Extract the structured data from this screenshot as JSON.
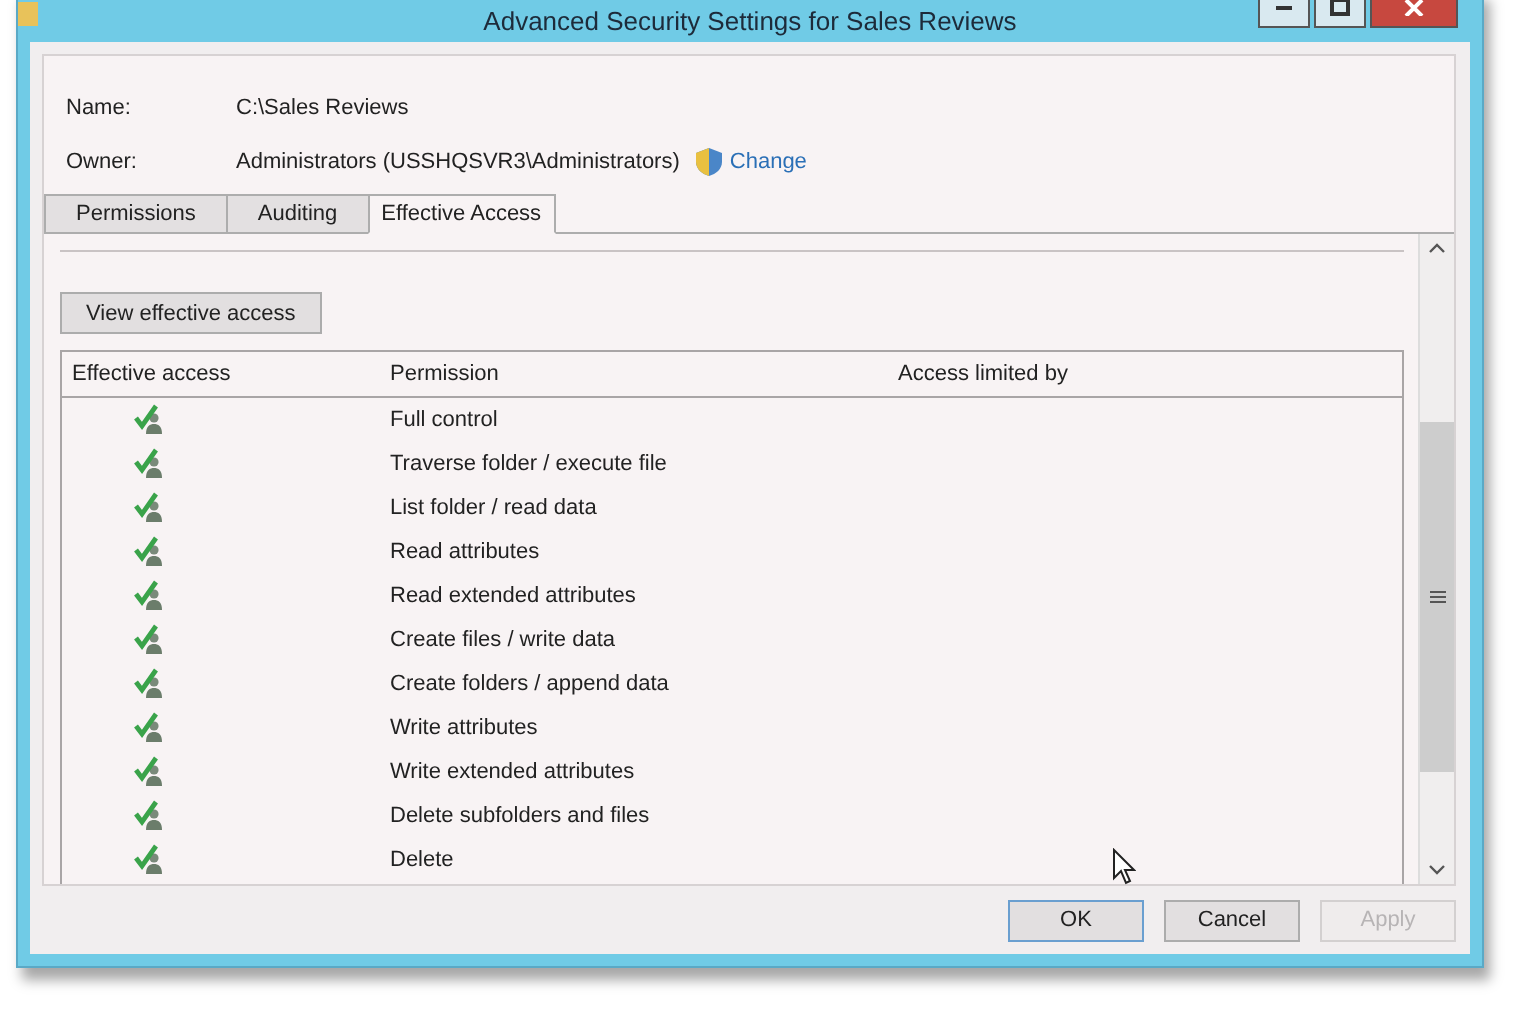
{
  "window": {
    "title": "Advanced Security Settings for Sales Reviews"
  },
  "name": {
    "label": "Name:",
    "value": "C:\\Sales Reviews"
  },
  "owner": {
    "label": "Owner:",
    "value": "Administrators (USSHQSVR3\\Administrators)",
    "change_link": "Change"
  },
  "tabs": [
    {
      "label": "Permissions",
      "selected": false
    },
    {
      "label": "Auditing",
      "selected": false
    },
    {
      "label": "Effective Access",
      "selected": true
    }
  ],
  "view_button": "View effective access",
  "table": {
    "columns": [
      "Effective access",
      "Permission",
      "Access limited by"
    ],
    "rows": [
      {
        "permission": "Full control"
      },
      {
        "permission": "Traverse folder / execute file"
      },
      {
        "permission": "List folder / read data"
      },
      {
        "permission": "Read attributes"
      },
      {
        "permission": "Read extended attributes"
      },
      {
        "permission": "Create files / write data"
      },
      {
        "permission": "Create folders / append data"
      },
      {
        "permission": "Write attributes"
      },
      {
        "permission": "Write extended attributes"
      },
      {
        "permission": "Delete subfolders and files"
      },
      {
        "permission": "Delete"
      }
    ]
  },
  "buttons": [
    {
      "label": "OK",
      "default": true,
      "disabled": false
    },
    {
      "label": "Cancel",
      "default": false,
      "disabled": false
    },
    {
      "label": "Apply",
      "default": false,
      "disabled": true
    }
  ]
}
